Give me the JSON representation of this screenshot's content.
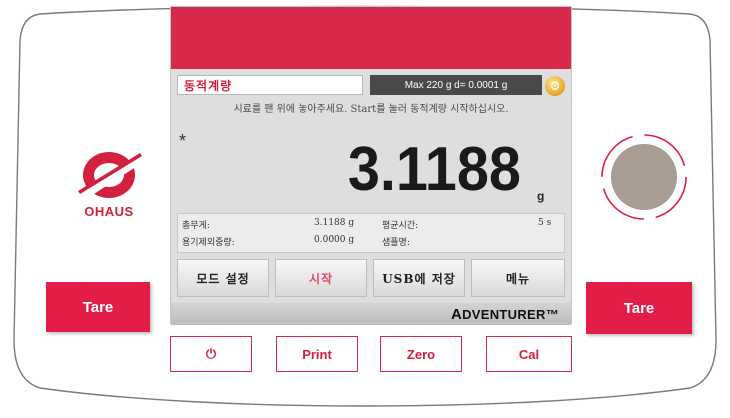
{
  "logo": {
    "text": "OHAUS"
  },
  "side": {
    "left_tare": "Tare",
    "right_tare": "Tare"
  },
  "screen": {
    "mode_title": "동적계량",
    "capacity": "Max 220 g  d= 0.0001 g",
    "settings_icon": "gear-icon",
    "instruction": "시료를 팬 위에 놓아주세요. Start를 눌러 동적계량 시작하십시오.",
    "stable_mark": "*",
    "reading": "3.1188",
    "unit": "g",
    "info": {
      "gross_label": "총무게:",
      "gross_value": "3.1188 g",
      "tare_label": "용기제외중량:",
      "tare_value": "0.0000 g",
      "avg_time_label": "평균시간:",
      "avg_time_value": "5 s",
      "sample_label": "샘플명:",
      "sample_value": ""
    },
    "softkeys": [
      "모드 설정",
      "시작",
      "USB에 저장",
      "메뉴"
    ],
    "brand_first": "A",
    "brand_rest": "DVENTURER",
    "brand_tm": "™"
  },
  "keys": {
    "power_symbol": "⏻",
    "print": "Print",
    "zero": "Zero",
    "cal": "Cal"
  },
  "colors": {
    "accent": "#d6294c",
    "screen_bg": "#dedede",
    "brand_red": "#d2203e"
  }
}
